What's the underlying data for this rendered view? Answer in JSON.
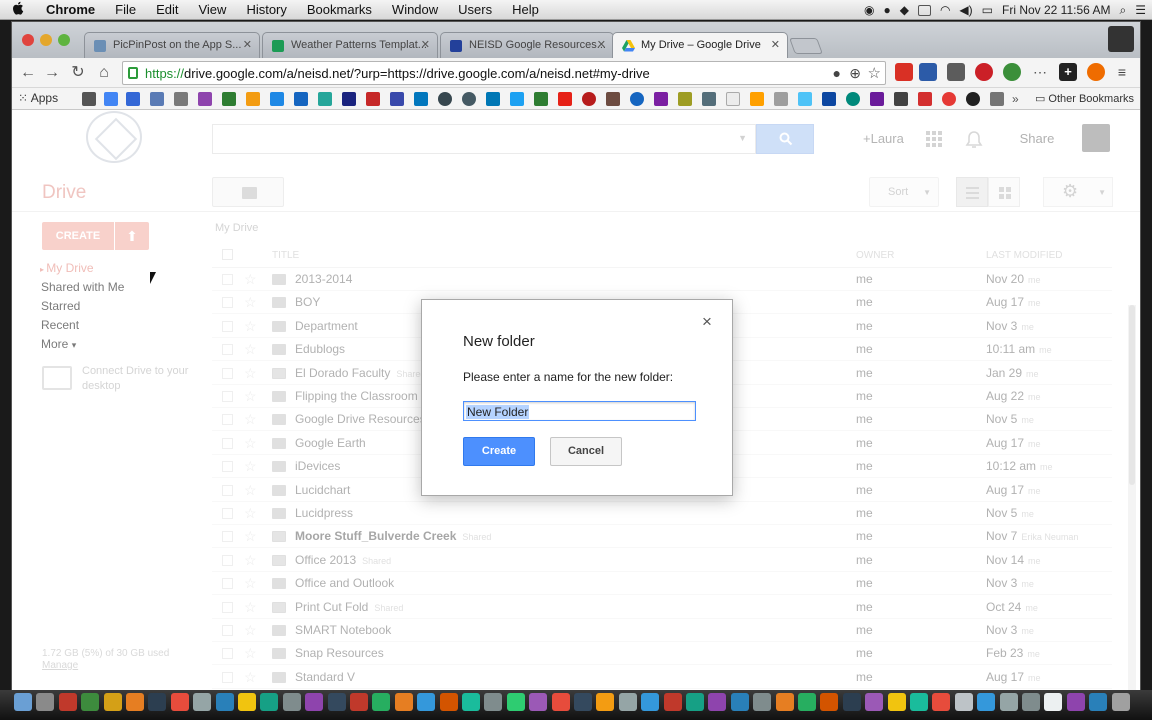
{
  "menubar": {
    "apple": "",
    "items": [
      "Chrome",
      "File",
      "Edit",
      "View",
      "History",
      "Bookmarks",
      "Window",
      "Users",
      "Help"
    ],
    "clock": "Fri Nov 22  11:56 AM"
  },
  "tabs": [
    {
      "label": "PicPinPost on the App S...",
      "icon_color": "#6b8fb5"
    },
    {
      "label": "Weather Patterns Templat...",
      "icon_color": "#1c9b55"
    },
    {
      "label": "NEISD Google Resources...",
      "icon_color": "#23409a"
    },
    {
      "label": "My Drive – Google Drive",
      "icon_color": "#f4c20d",
      "active": true
    }
  ],
  "address": {
    "scheme": "https://",
    "rest": "drive.google.com/a/neisd.net/?urp=https://drive.google.com/a/neisd.net#my-drive"
  },
  "bookmarks": {
    "apps": "Apps",
    "other": "Other Bookmarks"
  },
  "header": {
    "user_link": "+Laura",
    "share": "Share"
  },
  "subbar": {
    "title": "Drive",
    "sort": "Sort"
  },
  "sidebar": {
    "create": "CREATE",
    "upload_icon": "⬆",
    "items": [
      "My Drive",
      "Shared with Me",
      "Starred",
      "Recent",
      "More"
    ],
    "more_caret": "▾",
    "connect": "Connect Drive to your desktop",
    "storage": "1.72 GB (5%) of 30 GB used",
    "manage": "Manage"
  },
  "list": {
    "breadcrumb": "My Drive",
    "columns": {
      "title": "TITLE",
      "owner": "OWNER",
      "modified": "LAST MODIFIED"
    },
    "rows": [
      {
        "name": "2013-2014",
        "tag": "",
        "owner": "me",
        "date": "Nov 20",
        "by": "me",
        "shared": false
      },
      {
        "name": "BOY",
        "tag": "",
        "owner": "me",
        "date": "Aug 17",
        "by": "me",
        "shared": false
      },
      {
        "name": "Department",
        "tag": "",
        "owner": "me",
        "date": "Nov 3",
        "by": "me",
        "shared": false
      },
      {
        "name": "Edublogs",
        "tag": "",
        "owner": "me",
        "date": "10:11 am",
        "by": "me",
        "shared": false
      },
      {
        "name": "El Dorado Faculty",
        "tag": "Shared",
        "owner": "me",
        "date": "Jan 29",
        "by": "me",
        "shared": true
      },
      {
        "name": "Flipping the Classroom",
        "tag": "",
        "owner": "me",
        "date": "Aug 22",
        "by": "me",
        "shared": false
      },
      {
        "name": "Google Drive Resources",
        "tag": "",
        "owner": "me",
        "date": "Nov 5",
        "by": "me",
        "shared": false
      },
      {
        "name": "Google Earth",
        "tag": "",
        "owner": "me",
        "date": "Aug 17",
        "by": "me",
        "shared": false
      },
      {
        "name": "iDevices",
        "tag": "",
        "owner": "me",
        "date": "10:12 am",
        "by": "me",
        "shared": false
      },
      {
        "name": "Lucidchart",
        "tag": "",
        "owner": "me",
        "date": "Aug 17",
        "by": "me",
        "shared": false
      },
      {
        "name": "Lucidpress",
        "tag": "",
        "owner": "me",
        "date": "Nov 5",
        "by": "me",
        "shared": false
      },
      {
        "name": "Moore Stuff_Bulverde Creek",
        "tag": "Shared",
        "owner": "me",
        "date": "Nov 7",
        "by": "Erika Neuman",
        "shared": true,
        "bold": true
      },
      {
        "name": "Office 2013",
        "tag": "Shared",
        "owner": "me",
        "date": "Nov 14",
        "by": "me",
        "shared": true
      },
      {
        "name": "Office and Outlook",
        "tag": "",
        "owner": "me",
        "date": "Nov 3",
        "by": "me",
        "shared": false
      },
      {
        "name": "Print Cut Fold",
        "tag": "Shared",
        "owner": "me",
        "date": "Oct 24",
        "by": "me",
        "shared": true
      },
      {
        "name": "SMART Notebook",
        "tag": "",
        "owner": "me",
        "date": "Nov 3",
        "by": "me",
        "shared": false
      },
      {
        "name": "Snap Resources",
        "tag": "",
        "owner": "me",
        "date": "Feb 23",
        "by": "me",
        "shared": false
      },
      {
        "name": "Standard V",
        "tag": "",
        "owner": "me",
        "date": "Aug 17",
        "by": "me",
        "shared": false
      }
    ]
  },
  "dialog": {
    "title": "New folder",
    "close": "×",
    "prompt": "Please enter a name for the new folder:",
    "value": "New Folder",
    "create": "Create",
    "cancel": "Cancel"
  },
  "colors": {
    "accent": "#4d90fe",
    "drive_red": "#e8a7a0"
  }
}
